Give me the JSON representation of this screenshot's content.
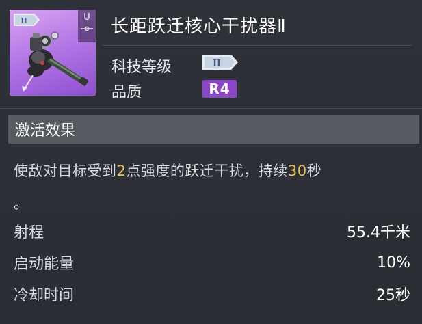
{
  "item": {
    "name": "长距跃迁核心干扰器Ⅱ",
    "thumb_tier": "II",
    "thumb_side_label": "U",
    "art_icon": "weapon-cannon-icon"
  },
  "attributes": {
    "tech_level_label": "科技等级",
    "tech_level_value": "II",
    "quality_label": "品质",
    "quality_value": "R4"
  },
  "effect": {
    "section_title": "激活效果",
    "desc_prefix": "使敌对目标受到",
    "strength_value": "2",
    "desc_middle": "点强度的跃迁干扰，持续",
    "duration_value": "30",
    "desc_suffix": "秒",
    "desc_end": "。"
  },
  "stats": [
    {
      "label": "射程",
      "value": "55.4千米"
    },
    {
      "label": "启动能量",
      "value": "10%"
    },
    {
      "label": "冷却时间",
      "value": "25秒"
    }
  ],
  "colors": {
    "background": "#2b2f36",
    "highlight": "#f2c24e",
    "quality_badge": "#8b46c8",
    "thumb_purple": "#b578e6",
    "section_bar": "#565b62"
  }
}
